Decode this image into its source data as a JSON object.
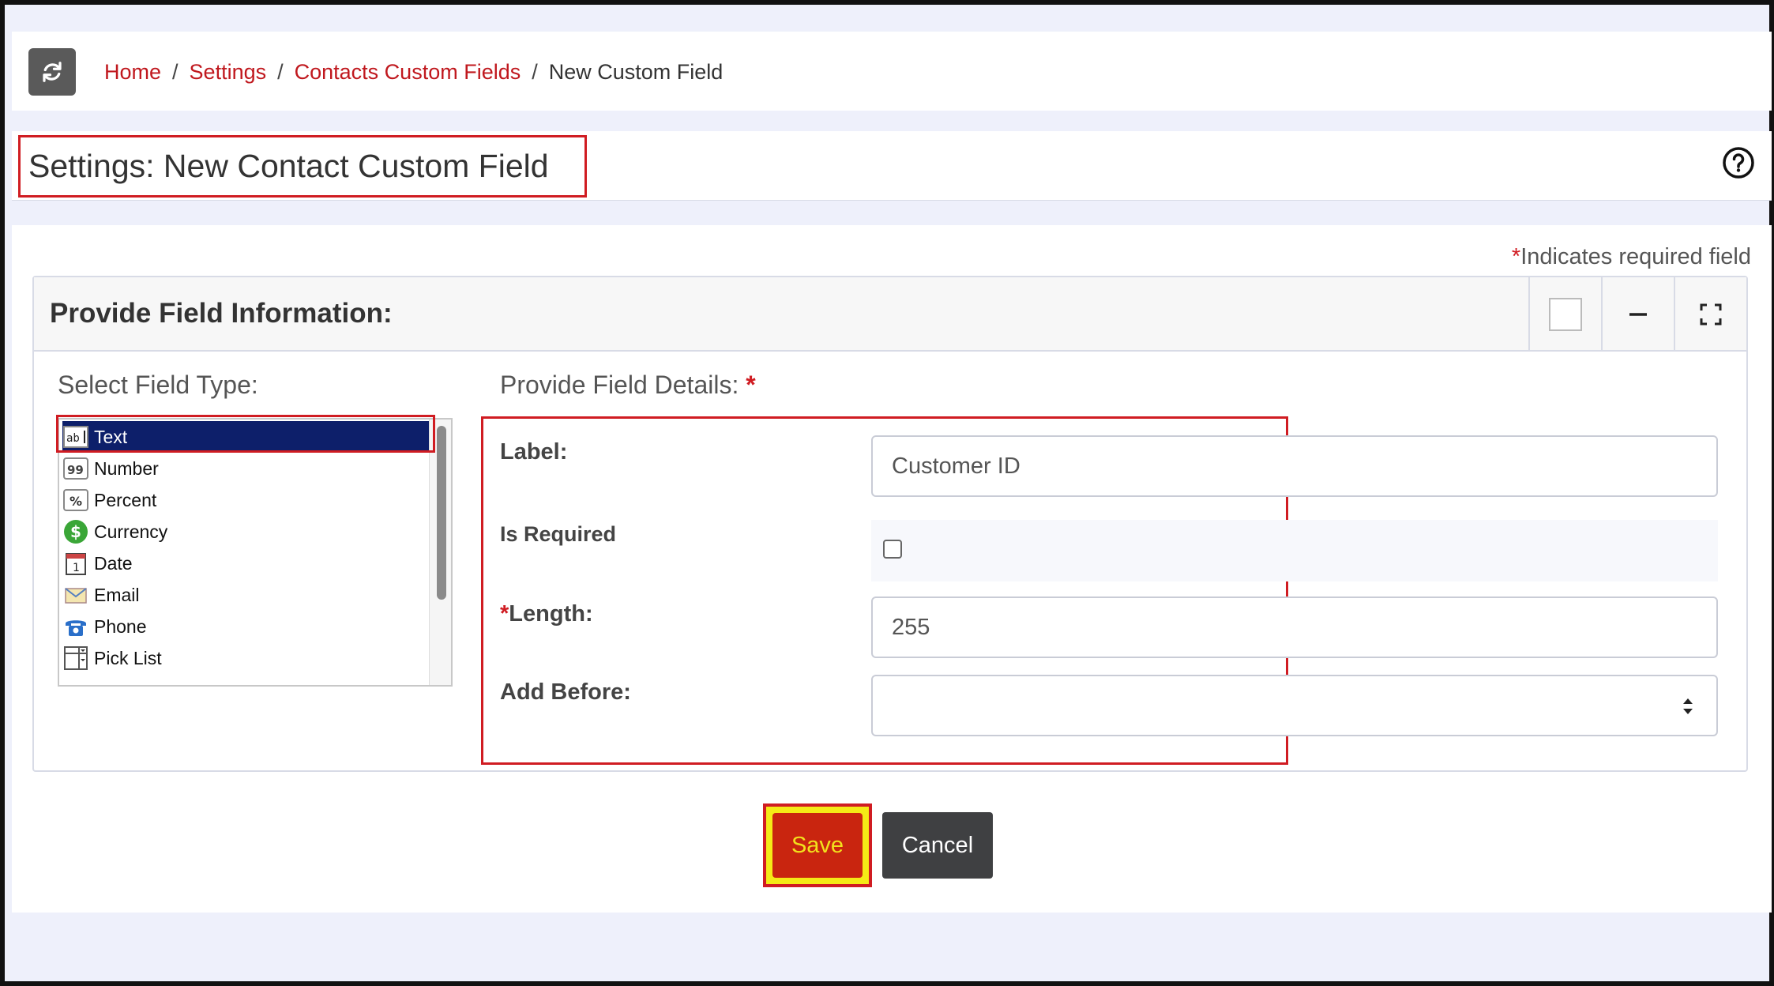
{
  "breadcrumb": {
    "home": "Home",
    "settings": "Settings",
    "contacts_custom_fields": "Contacts Custom Fields",
    "current": "New Custom Field",
    "separator": "/"
  },
  "page": {
    "title": "Settings: New Contact Custom Field",
    "required_note_star": "*",
    "required_note": "Indicates required field"
  },
  "card": {
    "title": "Provide Field Information:"
  },
  "field_type": {
    "heading": "Select Field Type:",
    "selected": "Text",
    "options": [
      {
        "label": "Text",
        "icon": "text-field-icon"
      },
      {
        "label": "Number",
        "icon": "number-icon"
      },
      {
        "label": "Percent",
        "icon": "percent-icon"
      },
      {
        "label": "Currency",
        "icon": "currency-icon"
      },
      {
        "label": "Date",
        "icon": "calendar-icon"
      },
      {
        "label": "Email",
        "icon": "email-icon"
      },
      {
        "label": "Phone",
        "icon": "phone-icon"
      },
      {
        "label": "Pick List",
        "icon": "pick-list-icon"
      }
    ]
  },
  "details": {
    "heading": "Provide Field Details:",
    "heading_star": "*",
    "label_label": "Label:",
    "label_value": "Customer ID",
    "is_required_label": "Is Required",
    "is_required_checked": false,
    "length_star": "*",
    "length_label": "Length:",
    "length_value": "255",
    "add_before_label": "Add Before:",
    "add_before_value": ""
  },
  "buttons": {
    "save": "Save",
    "cancel": "Cancel"
  },
  "colors": {
    "link": "#c0181e",
    "highlight": "#d01c22",
    "selected_bg": "#0d1f6a",
    "save_bg": "#c9250f",
    "save_text": "#f2e11c",
    "cancel_bg": "#3f4042"
  }
}
